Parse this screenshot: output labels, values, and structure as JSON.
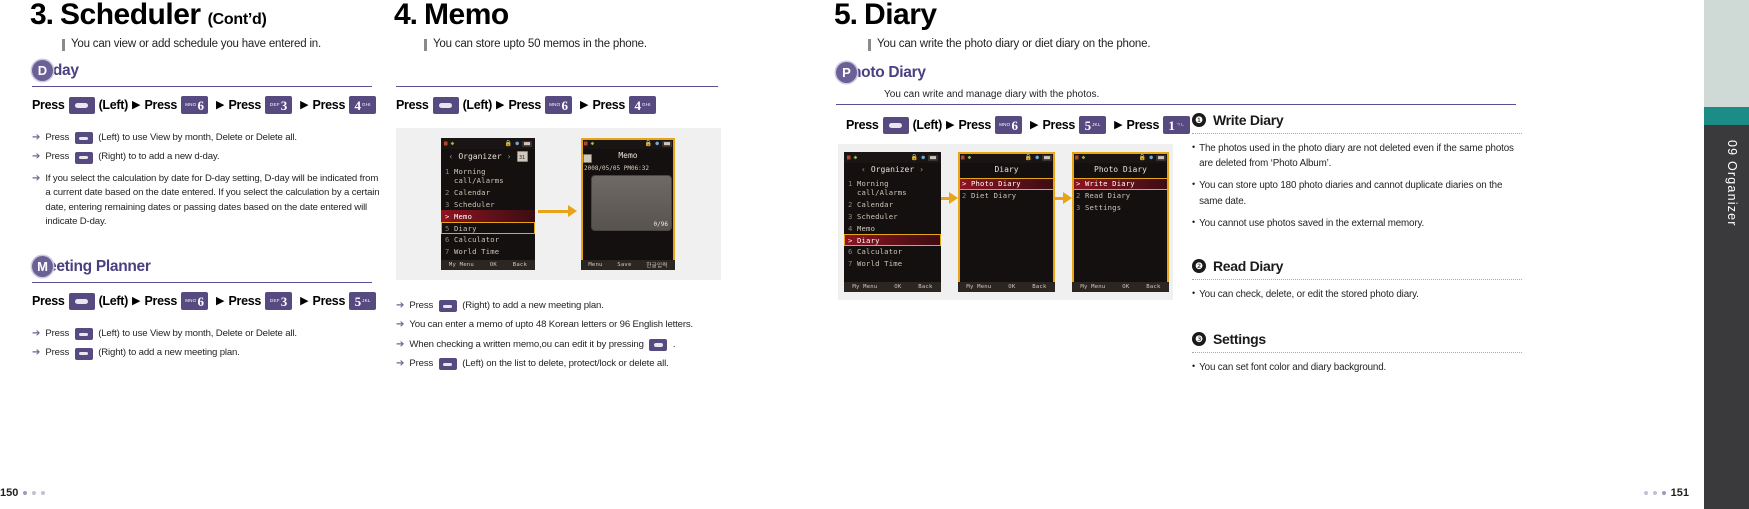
{
  "edge_tab": {
    "label": "09 Organizer"
  },
  "footer": {
    "left_page": "150",
    "right_page": "151"
  },
  "col1": {
    "section_number": "3.",
    "section_title": "Scheduler",
    "section_cont": "(Cont’d)",
    "lead": "You can view or add schedule you have entered in.",
    "dday": {
      "initial": "D",
      "title_rest": "-day",
      "keyline": {
        "press": "Press",
        "left_label": "(Left)",
        "keys": [
          {
            "digit": "6",
            "letters": "MNO",
            "side": "pre"
          },
          {
            "digit": "3",
            "letters": "DEF",
            "side": "pre"
          },
          {
            "digit": "4",
            "letters": "GHI",
            "side": "post"
          }
        ]
      },
      "bullets": [
        {
          "pre": "Press",
          "key": "softkey",
          "post": "(Left) to use View by month, Delete or Delete all."
        },
        {
          "pre": "Press",
          "key": "softkey",
          "post": "(Right) to to add a new d-day."
        },
        {
          "pre": "",
          "key": "none",
          "post": "If you select the calculation by date for D-day setting, D-day will be indicated from a current date based on the date entered. If you select the calculation by a certain date, entering remaining dates or passing dates based on the date entered will indicate D-day."
        }
      ]
    },
    "meeting": {
      "initial": "M",
      "title_rest": "eeting Planner",
      "keyline": {
        "press": "Press",
        "left_label": "(Left)",
        "keys": [
          {
            "digit": "6",
            "letters": "MNO",
            "side": "pre"
          },
          {
            "digit": "3",
            "letters": "DEF",
            "side": "pre"
          },
          {
            "digit": "5",
            "letters": "JKL",
            "side": "post"
          }
        ]
      },
      "bullets": [
        {
          "pre": "Press",
          "key": "softkey",
          "post": "(Left) to use View by month, Delete or Delete all."
        },
        {
          "pre": "Press",
          "key": "softkey",
          "post": "(Right) to add a new meeting plan."
        }
      ]
    }
  },
  "col2": {
    "section_number": "4.",
    "section_title": "Memo",
    "lead": "You can store upto 50 memos in the phone.",
    "keyline": {
      "press": "Press",
      "left_label": "(Left)",
      "keys": [
        {
          "digit": "6",
          "letters": "MNO",
          "side": "pre"
        },
        {
          "digit": "4",
          "letters": "GHI",
          "side": "post"
        }
      ]
    },
    "screens": {
      "organizer": {
        "title": "Organizer",
        "items": [
          {
            "n": "1",
            "label": "Morning call/Alarms"
          },
          {
            "n": "2",
            "label": "Calendar"
          },
          {
            "n": "3",
            "label": "Scheduler"
          },
          {
            "n": "4",
            "label": "Memo"
          },
          {
            "n": "5",
            "label": "Diary"
          },
          {
            "n": "6",
            "label": "Calculator"
          },
          {
            "n": "7",
            "label": "World Time"
          }
        ],
        "softkeys": [
          "My Menu",
          "OK",
          "Back"
        ],
        "cal_icon_text": "31"
      },
      "memo": {
        "title": "Memo",
        "date": "2008/05/05 PM06:32",
        "counter": "0/96",
        "softkeys": [
          "Menu",
          "Save",
          "한글입력"
        ]
      }
    },
    "bullets": [
      {
        "pre": "Press",
        "key": "softkey",
        "post": "(Right) to add a new meeting plan."
      },
      {
        "pre": "",
        "key": "none",
        "post": "You can enter a memo of upto 48 Korean letters or 96 English letters."
      },
      {
        "pre": "",
        "key": "trailing",
        "mid": "When checking a written memo,ou can edit it by pressing",
        "post": "."
      },
      {
        "pre": "Press",
        "key": "softkey",
        "post": "(Left) on the list to delete, protect/lock or delete all."
      }
    ]
  },
  "col3": {
    "section_number": "5.",
    "section_title": "Diary",
    "lead": "You can write the photo diary or diet diary on the phone.",
    "sub": {
      "initial": "P",
      "title_rest": "hoto Diary",
      "note": "You can write and manage diary with the photos."
    },
    "keyline": {
      "press": "Press",
      "left_label": "(Left)",
      "keys": [
        {
          "digit": "6",
          "letters": "MNO",
          "side": "pre"
        },
        {
          "digit": "5",
          "letters": "JKL",
          "side": "post"
        },
        {
          "digit": "1",
          "letters": "ㄱㄴ",
          "side": "post"
        }
      ]
    },
    "screens": {
      "organizer": {
        "title": "Organizer",
        "items": [
          {
            "n": "1",
            "label": "Morning call/Alarms"
          },
          {
            "n": "2",
            "label": "Calendar"
          },
          {
            "n": "3",
            "label": "Scheduler"
          },
          {
            "n": "4",
            "label": "Memo"
          },
          {
            "n": "5",
            "label": "Diary"
          },
          {
            "n": "6",
            "label": "Calculator"
          },
          {
            "n": "7",
            "label": "World Time"
          }
        ],
        "softkeys": [
          "My Menu",
          "OK",
          "Back"
        ]
      },
      "diary": {
        "title": "Diary",
        "items": [
          {
            "n": "1",
            "label": "Photo Diary"
          },
          {
            "n": "2",
            "label": "Diet Diary"
          }
        ],
        "softkeys": [
          "My Menu",
          "OK",
          "Back"
        ]
      },
      "photodiary": {
        "title": "Photo Diary",
        "items": [
          {
            "n": "1",
            "label": "Write Diary"
          },
          {
            "n": "2",
            "label": "Read Diary"
          },
          {
            "n": "3",
            "label": "Settings"
          }
        ],
        "softkeys": [
          "My Menu",
          "OK",
          "Back"
        ]
      }
    },
    "entries": [
      {
        "num": "❶",
        "title": "Write Diary",
        "bullets": [
          "The photos used in the photo diary are not deleted even if the same photos are deleted from ‘Photo Album’.",
          "You can store upto 180 photo diaries and cannot duplicate diaries on the same date.",
          "You cannot use photos saved in the external memory."
        ]
      },
      {
        "num": "❷",
        "title": "Read Diary",
        "bullets": [
          "You can check, delete, or edit the stored photo diary."
        ]
      },
      {
        "num": "❸",
        "title": "Settings",
        "bullets": [
          "You can set font color and diary background."
        ]
      }
    ]
  }
}
